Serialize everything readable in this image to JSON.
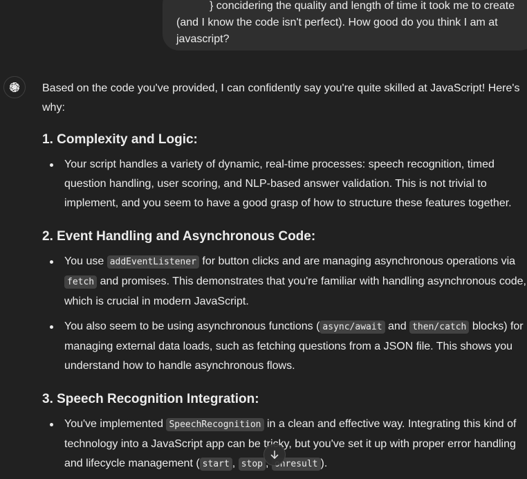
{
  "user_message": {
    "line1": "} concidering the quality and length of time it took me to create",
    "line2": "(and I know the code isn't perfect). How good do you think I am at",
    "line3": "javascript?"
  },
  "assistant": {
    "intro": "Based on the code you've provided, I can confidently say you're quite skilled at JavaScript! Here's why:",
    "sections": [
      {
        "heading": "1. Complexity and Logic:",
        "bullets": [
          {
            "text": "Your script handles a variety of dynamic, real-time processes: speech recognition, timed question handling, user scoring, and NLP-based answer validation. This is not trivial to implement, and you seem to have a good grasp of how to structure these features together."
          }
        ]
      },
      {
        "heading": "2. Event Handling and Asynchronous Code:",
        "bullets": [
          {
            "t1": "You use ",
            "c1": "addEventListener",
            "t2": " for button clicks and are managing asynchronous operations via ",
            "c2": "fetch",
            "t3": " and promises. This demonstrates that you're familiar with handling asynchronous code, which is crucial in modern JavaScript."
          },
          {
            "t1": "You also seem to be using asynchronous functions (",
            "c1": "async/await",
            "t2": " and ",
            "c2": "then/catch",
            "t3": " blocks) for managing external data loads, such as fetching questions from a JSON file. This shows you understand how to handle asynchronous flows."
          }
        ]
      },
      {
        "heading": "3. Speech Recognition Integration:",
        "bullets": [
          {
            "t1": "You've implemented ",
            "c1": "SpeechRecognition",
            "t2": " in a clean and effective way. Integrating this kind of technology into a JavaScript app can be tricky, but you've set it up with proper error handling and lifecycle management (",
            "c2": "start",
            "t3": ", ",
            "c3": "stop",
            "t4": ", ",
            "c4": "onresult",
            "t5": ")."
          }
        ]
      }
    ]
  },
  "icons": {
    "avatar": "openai-logo-icon",
    "scroll": "arrow-down-icon"
  }
}
